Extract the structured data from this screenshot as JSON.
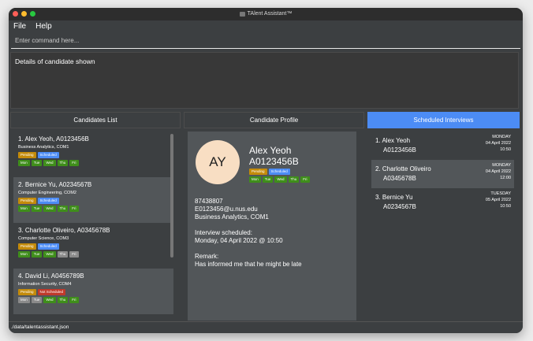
{
  "window": {
    "title": "TAlent Assistant™",
    "lights": [
      "#ff5f57",
      "#febc2e",
      "#28c840"
    ]
  },
  "menu": {
    "file": "File",
    "help": "Help"
  },
  "command": {
    "placeholder": "Enter command here..."
  },
  "result": {
    "text": "Details of candidate shown"
  },
  "panels": {
    "candidates_title": "Candidates List",
    "profile_title": "Candidate Profile",
    "interviews_title": "Scheduled Interviews"
  },
  "candidates": [
    {
      "name": "1.  Alex Yeoh, A0123456B",
      "course": "Business Analytics, COM1",
      "tags": [
        {
          "label": "Pending",
          "kind": "pending"
        },
        {
          "label": "Scheduled",
          "kind": "scheduled"
        }
      ],
      "days": [
        {
          "label": "Mon",
          "on": true
        },
        {
          "label": "Tue",
          "on": true
        },
        {
          "label": "Wed",
          "on": true
        },
        {
          "label": "Thu",
          "on": true
        },
        {
          "label": "Fri",
          "on": true
        }
      ]
    },
    {
      "name": "2.  Bernice Yu, A0234567B",
      "course": "Computer Engineering, COM2",
      "tags": [
        {
          "label": "Pending",
          "kind": "pending"
        },
        {
          "label": "Scheduled",
          "kind": "scheduled"
        }
      ],
      "days": [
        {
          "label": "Mon",
          "on": true
        },
        {
          "label": "Tue",
          "on": true
        },
        {
          "label": "Wed",
          "on": true
        },
        {
          "label": "Thu",
          "on": true
        },
        {
          "label": "Fri",
          "on": true
        }
      ]
    },
    {
      "name": "3.  Charlotte Oliveiro, A0345678B",
      "course": "Computer Science, COM3",
      "tags": [
        {
          "label": "Pending",
          "kind": "pending"
        },
        {
          "label": "Scheduled",
          "kind": "scheduled"
        }
      ],
      "days": [
        {
          "label": "Mon",
          "on": true
        },
        {
          "label": "Tue",
          "on": true
        },
        {
          "label": "Wed",
          "on": true
        },
        {
          "label": "Thu",
          "on": false
        },
        {
          "label": "Fri",
          "on": false
        }
      ]
    },
    {
      "name": "4.  David Li, A0456789B",
      "course": "Information Security, COM4",
      "tags": [
        {
          "label": "Pending",
          "kind": "pending"
        },
        {
          "label": "Not Scheduled",
          "kind": "not-scheduled"
        }
      ],
      "days": [
        {
          "label": "Mon",
          "on": false
        },
        {
          "label": "Tue",
          "on": false
        },
        {
          "label": "Wed",
          "on": true
        },
        {
          "label": "Thu",
          "on": true
        },
        {
          "label": "Fri",
          "on": true
        }
      ]
    }
  ],
  "profile": {
    "initials": "AY",
    "name": "Alex Yeoh",
    "id": "A0123456B",
    "tags": [
      {
        "label": "Pending",
        "kind": "pending"
      },
      {
        "label": "Scheduled",
        "kind": "scheduled"
      }
    ],
    "days": [
      {
        "label": "Mon",
        "on": true
      },
      {
        "label": "Tue",
        "on": true
      },
      {
        "label": "Wed",
        "on": true
      },
      {
        "label": "Thu",
        "on": true
      },
      {
        "label": "Fri",
        "on": true
      }
    ],
    "phone": "87438807",
    "email": "E0123456@u.nus.edu",
    "course": "Business Analytics, COM1",
    "interview_label": "Interview scheduled:",
    "interview_time": "Monday, 04 April 2022  @ 10:50",
    "remark_label": "Remark:",
    "remark": "Has informed me that he might be late"
  },
  "interviews": [
    {
      "name": "1.  Alex Yeoh",
      "id": "A0123456B",
      "day": "MONDAY",
      "date": "04 April 2022",
      "time": "10:50"
    },
    {
      "name": "2.  Charlotte Oliveiro",
      "id": "A0345678B",
      "day": "MONDAY",
      "date": "04 April 2022",
      "time": "12:00"
    },
    {
      "name": "3.  Bernice Yu",
      "id": "A0234567B",
      "day": "TUESDAY",
      "date": "05 April 2022",
      "time": "10:50"
    }
  ],
  "status": {
    "path": "./data/talentassistant.json"
  }
}
